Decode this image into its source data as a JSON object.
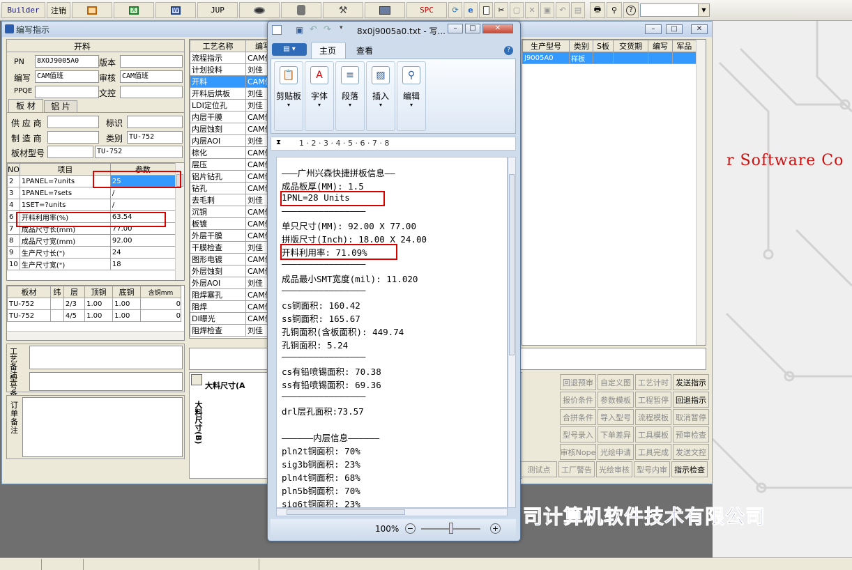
{
  "toolbar": {
    "builder": "Builder",
    "logout": "注销",
    "jup": "JUP",
    "spc": "SPC"
  },
  "main_window": {
    "title": "编写指示"
  },
  "kailiao": {
    "header": "开料",
    "pn_label": "PN",
    "pn_value": "8XOJ9005A0",
    "version_label": "版本",
    "version_value": "",
    "author_label": "编写",
    "author_value": "CAM值班",
    "review_label": "审核",
    "review_value": "CAM值班",
    "ppqe_label": "PPQE",
    "ppqe_value": "",
    "control_label": "文控",
    "control_value": "",
    "tabs": [
      "板 材",
      "铝 片"
    ],
    "supplier_label": "供 应 商",
    "supplier_value": "",
    "mark_label": "标识",
    "mark_value": "",
    "maker_label": "制 造 商",
    "maker_value": "",
    "category_label": "类别",
    "category_value": "TU-752",
    "board_model_label": "板材型号",
    "board_model_value": "TU-752"
  },
  "params_table": {
    "headers": [
      "NO",
      "项目",
      "参数"
    ],
    "rows": [
      {
        "no": "2",
        "item": "1PANEL=?units",
        "value": "25"
      },
      {
        "no": "3",
        "item": "1PANEL=?sets",
        "value": "/"
      },
      {
        "no": "4",
        "item": "1SET=?units",
        "value": "/"
      },
      {
        "no": "6",
        "item": "开料利用率(%)",
        "value": "63.54"
      },
      {
        "no": "7",
        "item": "成品尺寸长(mm)",
        "value": "77.00"
      },
      {
        "no": "8",
        "item": "成品尺寸宽(mm)",
        "value": "92.00"
      },
      {
        "no": "9",
        "item": "生产尺寸长(\")",
        "value": "24"
      },
      {
        "no": "10",
        "item": "生产尺寸宽(\")",
        "value": "18"
      }
    ]
  },
  "board_table": {
    "headers": [
      "板材",
      "纬",
      "层",
      "顶铜",
      "底铜",
      "含铜mm"
    ],
    "rows": [
      {
        "board": "TU-752",
        "weft": "",
        "layer": "2/3",
        "top": "1.00",
        "bottom": "1.00",
        "cu": "0"
      },
      {
        "board": "TU-752",
        "weft": "",
        "layer": "4/5",
        "top": "1.00",
        "bottom": "1.00",
        "cu": "0"
      }
    ]
  },
  "notes": {
    "process": "工艺备注",
    "model": "型号备注",
    "order": "订单备注"
  },
  "process_list": {
    "headers": [
      "工艺名称",
      "编写"
    ],
    "rows": [
      {
        "name": "流程指示",
        "writer": "CAM值"
      },
      {
        "name": "计划投料",
        "writer": "刘佳"
      },
      {
        "name": "开料",
        "writer": "CAM值"
      },
      {
        "name": "开料后烘板",
        "writer": "刘佳"
      },
      {
        "name": "LDI定位孔",
        "writer": "刘佳"
      },
      {
        "name": "内层干膜",
        "writer": "CAM值"
      },
      {
        "name": "内层蚀刻",
        "writer": "CAM值"
      },
      {
        "name": "内层AOI",
        "writer": "刘佳"
      },
      {
        "name": "棕化",
        "writer": "CAM值"
      },
      {
        "name": "层压",
        "writer": "CAM值"
      },
      {
        "name": "铝片钻孔",
        "writer": "CAM值"
      },
      {
        "name": "钻孔",
        "writer": "CAM值"
      },
      {
        "name": "去毛刺",
        "writer": "刘佳"
      },
      {
        "name": "沉铜",
        "writer": "CAM值"
      },
      {
        "name": "板镀",
        "writer": "CAM值"
      },
      {
        "name": "外层干膜",
        "writer": "CAM值"
      },
      {
        "name": "干膜检查",
        "writer": "刘佳"
      },
      {
        "name": "图形电镀",
        "writer": "CAM值"
      },
      {
        "name": "外层蚀刻",
        "writer": "CAM值"
      },
      {
        "name": "外层AOI",
        "writer": "刘佳"
      },
      {
        "name": "阻焊塞孔",
        "writer": "CAM值"
      },
      {
        "name": "阻焊",
        "writer": "CAM值"
      },
      {
        "name": "DI曝光",
        "writer": "CAM值"
      },
      {
        "name": "阻焊检查",
        "writer": "刘佳"
      }
    ]
  },
  "order_table": {
    "headers": [
      "生产型号",
      "类别",
      "S板",
      "交货期",
      "编写",
      "军品"
    ],
    "row": {
      "model": "J9005A0",
      "category": "样板"
    }
  },
  "diagram": {
    "label_top": "大料尺寸(A",
    "label_side": "大料尺寸(B)"
  },
  "actions": [
    [
      "回退预审",
      "自定义图",
      "工艺计时",
      "发送指示"
    ],
    [
      "报价条件",
      "参数模板",
      "工程暂停",
      "回退指示"
    ],
    [
      "合拼条件",
      "导入型号",
      "流程模板",
      "取消暂停"
    ],
    [
      "型号录入",
      "下单差异",
      "工具模板",
      "预审检查"
    ],
    [
      "审核Nope",
      "光绘申请",
      "工具完成",
      "发送文控"
    ],
    [
      "测试点",
      "工厂警告",
      "光绘审核",
      "型号内审",
      "指示检查"
    ]
  ],
  "desktop": {
    "software_text": "r Software Co",
    "company_text": "司计算机软件技术有限公司"
  },
  "notepad": {
    "title": "8x0j9005a0.txt - 写...",
    "tabs": [
      "主页",
      "查看"
    ],
    "groups": [
      "剪贴板",
      "字体",
      "段落",
      "插入",
      "编辑"
    ],
    "ruler": "1 · 2 · 3 · 4 · 5 · 6 · 7 · 8",
    "zoom": "100%",
    "lines": [
      "———广州兴森快捷拼板信息——",
      "成品板厚(MM): 1.5",
      "1PNL=28 Units",
      "————————————————",
      "单只尺寸(MM): 92.00 X 77.00",
      "拼版尺寸(Inch): 18.00 X 24.00",
      "开料利用率: 71.09%",
      "————————————————",
      "成品最小SMT宽度(mil): 11.020",
      "————————————————",
      "cs铜面积: 160.42",
      "ss铜面积: 165.67",
      "孔铜面积(含板面积): 449.74",
      "孔铜面积: 5.24",
      "————————————————",
      "cs有铅喷锡面积: 70.38",
      "ss有铅喷锡面积: 69.36",
      "————————————————",
      "drl层孔面积:73.57",
      "",
      "——————内层信息——————",
      "pln2t铜面积: 70%",
      "sig3b铜面积: 23%",
      "pln4t铜面积: 68%",
      "pln5b铜面积: 70%",
      "sig6t铜面积: 23%"
    ]
  },
  "colors": {
    "accent": "#3399ff",
    "red": "#d90000",
    "title_bg": "#c3d3ea"
  }
}
